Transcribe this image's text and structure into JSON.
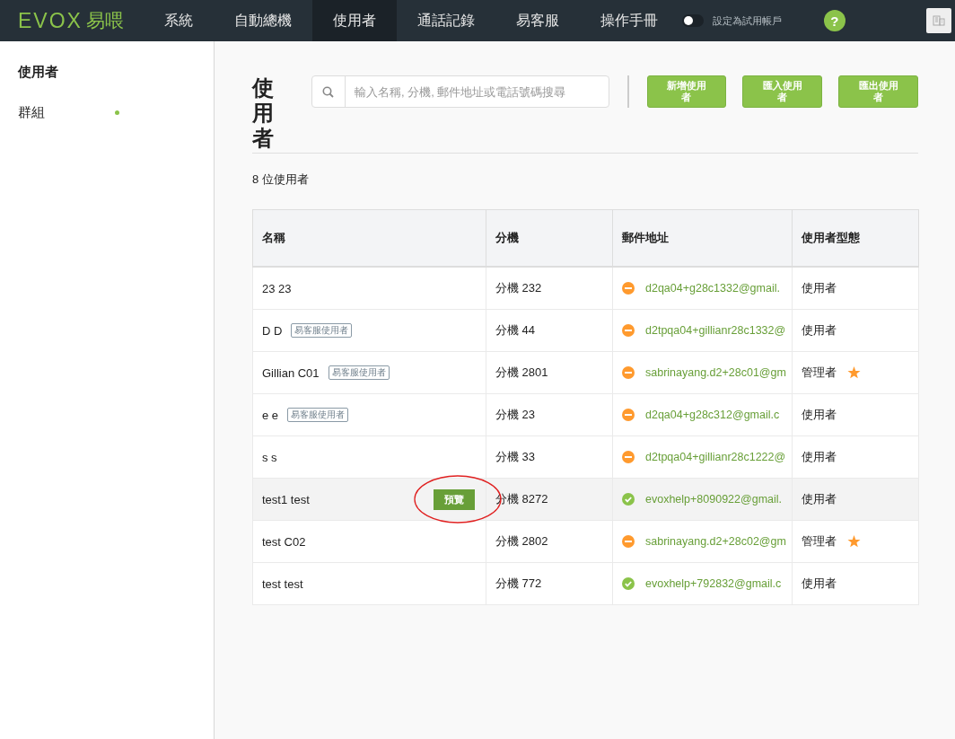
{
  "topbar": {
    "logo": "EVOX",
    "logo_suffix": "易喂",
    "nav": [
      {
        "label": "系統",
        "selected": false
      },
      {
        "label": "自動總機",
        "selected": false
      },
      {
        "label": "使用者",
        "selected": true
      },
      {
        "label": "通話記錄",
        "selected": false
      },
      {
        "label": "易客服",
        "selected": false
      },
      {
        "label": "操作手冊",
        "selected": false
      }
    ],
    "trial_toggle": {
      "label": "設定為試用帳戶",
      "on": false
    },
    "help": "?"
  },
  "sidebar": {
    "items": [
      {
        "label": "使用者",
        "selected": true,
        "indicator": false
      },
      {
        "label": "群組",
        "selected": false,
        "indicator": true
      }
    ]
  },
  "main": {
    "title": "使用者",
    "search": {
      "placeholder": "輸入名稱, 分機, 郵件地址或電話號碼搜尋"
    },
    "buttons": [
      "新增使用者",
      "匯入使用者",
      "匯出使用者"
    ],
    "count": "8 位使用者",
    "table": {
      "columns": [
        "名稱",
        "分機",
        "郵件地址",
        "使用者型態"
      ],
      "rows": [
        {
          "name": "23 23",
          "tag": "",
          "extension": "分機 232",
          "kind": "pending",
          "email": "d2qa04+g28c1332@gmail.",
          "role": "使用者",
          "admin": false,
          "hovered": false
        },
        {
          "name": "D D",
          "tag": "易客服使用者",
          "extension": "分機 44",
          "kind": "pending",
          "email": "d2tpqa04+gillianr28c1332@",
          "role": "使用者",
          "admin": false,
          "hovered": false
        },
        {
          "name": "Gillian C01",
          "tag": "易客服使用者",
          "extension": "分機 2801",
          "kind": "pending",
          "email": "sabrinayang.d2+28c01@gm",
          "role": "管理者",
          "admin": true,
          "hovered": false
        },
        {
          "name": "e e",
          "tag": "易客服使用者",
          "extension": "分機 23",
          "kind": "pending",
          "email": "d2qa04+g28c312@gmail.c",
          "role": "使用者",
          "admin": false,
          "hovered": false
        },
        {
          "name": "s s",
          "tag": "",
          "extension": "分機 33",
          "kind": "pending",
          "email": "d2tpqa04+gillianr28c1222@",
          "role": "使用者",
          "admin": false,
          "hovered": false
        },
        {
          "name": "test1 test",
          "tag": "",
          "extension": "分機 8272",
          "kind": "verified",
          "email": "evoxhelp+8090922@gmail.",
          "role": "使用者",
          "admin": false,
          "hovered": true,
          "preview": "預覽"
        },
        {
          "name": "test C02",
          "tag": "",
          "extension": "分機 2802",
          "kind": "pending",
          "email": "sabrinayang.d2+28c02@gm",
          "role": "管理者",
          "admin": true,
          "hovered": false
        },
        {
          "name": "test test",
          "tag": "",
          "extension": "分機 772",
          "kind": "verified",
          "email": "evoxhelp+792832@gmail.c",
          "role": "使用者",
          "admin": false,
          "hovered": false
        }
      ]
    }
  }
}
